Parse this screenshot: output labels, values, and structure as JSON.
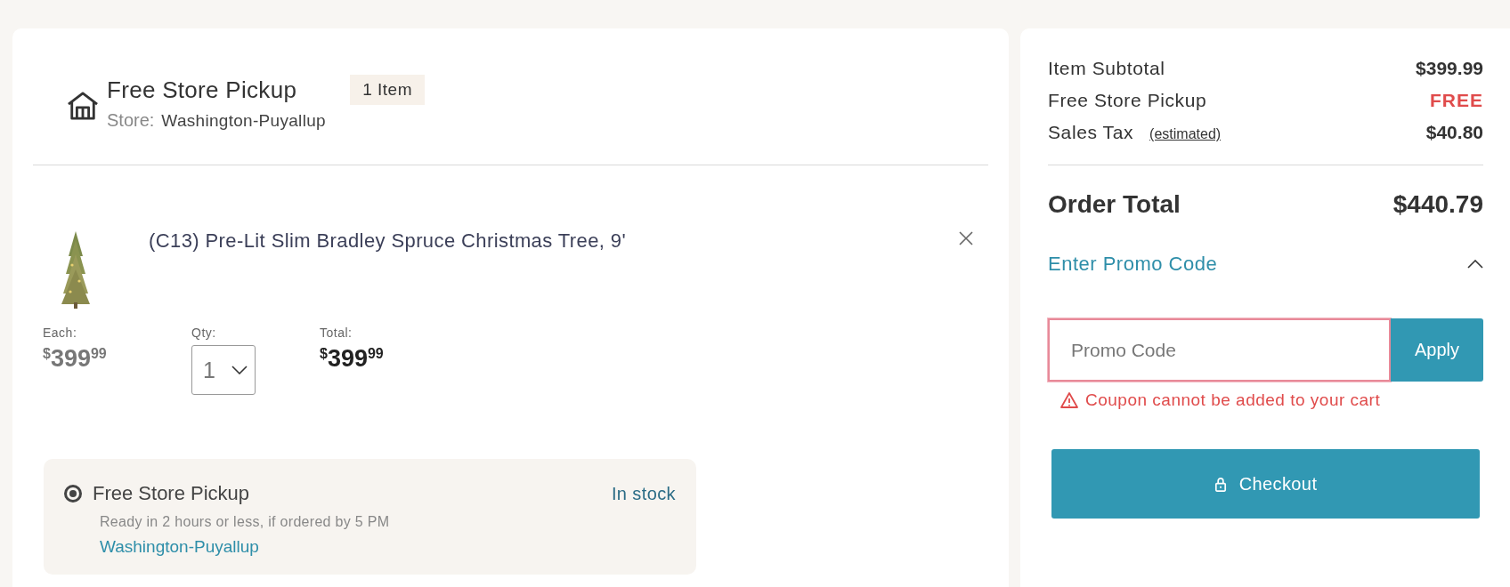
{
  "pickup_header": {
    "title": "Free Store Pickup",
    "badge": "1 Item",
    "store_label": "Store:",
    "store_name": "Washington-Puyallup"
  },
  "item": {
    "name": "(C13) Pre-Lit Slim Bradley Spruce Christmas Tree, 9'",
    "each": {
      "label": "Each:",
      "currency": "$",
      "dollars": "399",
      "cents": "99"
    },
    "qty": {
      "label": "Qty:",
      "value": "1"
    },
    "total": {
      "label": "Total:",
      "currency": "$",
      "dollars": "399",
      "cents": "99"
    }
  },
  "fulfillment_options": [
    {
      "title": "Free Store Pickup",
      "selected": true,
      "availability": "In stock",
      "note": "Ready in 2 hours or less, if ordered by 5 PM",
      "store": "Washington-Puyallup"
    }
  ],
  "summary": {
    "lines": [
      {
        "label": "Item Subtotal",
        "value": "$399.99",
        "kind": "plain"
      },
      {
        "label": "Free Store Pickup",
        "value": "FREE",
        "kind": "free"
      },
      {
        "label": "Sales Tax",
        "hint": "(estimated)",
        "value": "$40.80",
        "kind": "plain"
      }
    ],
    "total_label": "Order Total",
    "total_value": "$440.79"
  },
  "promo": {
    "toggle": "Enter Promo Code",
    "expanded": true,
    "placeholder": "Promo Code",
    "button": "Apply",
    "error": "Coupon cannot be added to your cart"
  },
  "checkout_button": "Checkout"
}
